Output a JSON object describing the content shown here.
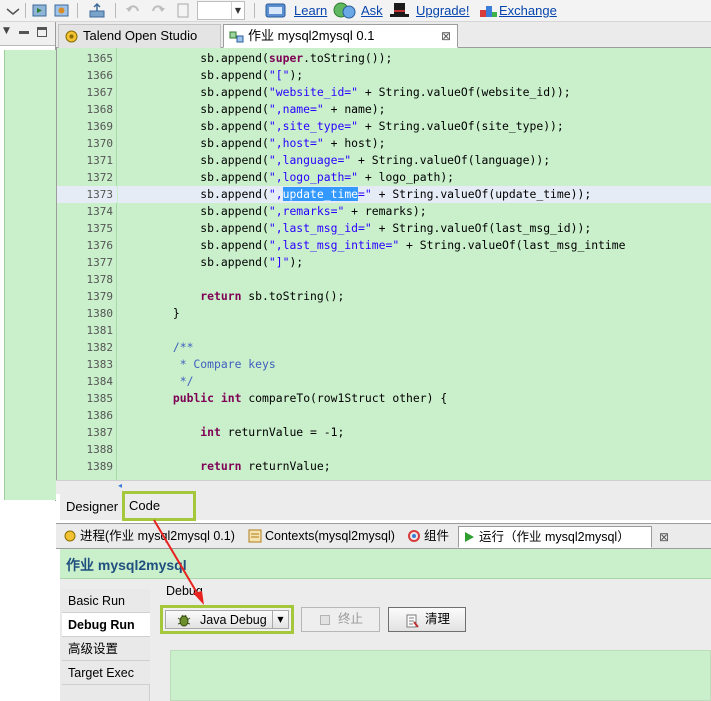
{
  "toolbar": {
    "links": [
      {
        "label": "Learn",
        "icon": "learn-icon"
      },
      {
        "label": "Ask",
        "icon": "ask-icon"
      },
      {
        "label": "Upgrade!",
        "icon": "upgrade-icon"
      },
      {
        "label": "Exchange",
        "icon": "exchange-icon"
      }
    ]
  },
  "editor_tabs": [
    {
      "label": "Talend Open Studio",
      "icon": "talend-icon"
    },
    {
      "label": "作业 mysql2mysql 0.1",
      "icon": "job-icon",
      "close": "⊠"
    }
  ],
  "code": {
    "line_numbers": [
      "1365",
      "1366",
      "1367",
      "1368",
      "1369",
      "1370",
      "1371",
      "1372",
      "1373",
      "1374",
      "1375",
      "1376",
      "1377",
      "1378",
      "1379",
      "1380",
      "1381",
      "1382",
      "1383",
      "1384",
      "1385",
      "1386",
      "1387",
      "1388",
      "1389"
    ],
    "lines": [
      [
        {
          "t": "            sb.append("
        },
        {
          "t": "super",
          "c": "kw"
        },
        {
          "t": ".toString());"
        }
      ],
      [
        {
          "t": "            sb.append("
        },
        {
          "t": "\"[\"",
          "c": "str"
        },
        {
          "t": ");"
        }
      ],
      [
        {
          "t": "            sb.append("
        },
        {
          "t": "\"website_id=\"",
          "c": "str"
        },
        {
          "t": " + String.valueOf(website_id));"
        }
      ],
      [
        {
          "t": "            sb.append("
        },
        {
          "t": "\",name=\"",
          "c": "str"
        },
        {
          "t": " + name);"
        }
      ],
      [
        {
          "t": "            sb.append("
        },
        {
          "t": "\",site_type=\"",
          "c": "str"
        },
        {
          "t": " + String.valueOf(site_type));"
        }
      ],
      [
        {
          "t": "            sb.append("
        },
        {
          "t": "\",host=\"",
          "c": "str"
        },
        {
          "t": " + host);"
        }
      ],
      [
        {
          "t": "            sb.append("
        },
        {
          "t": "\",language=\"",
          "c": "str"
        },
        {
          "t": " + String.valueOf(language));"
        }
      ],
      [
        {
          "t": "            sb.append("
        },
        {
          "t": "\",logo_path=\"",
          "c": "str"
        },
        {
          "t": " + logo_path);"
        }
      ],
      [
        {
          "t": "            sb.append("
        },
        {
          "t": "\",",
          "c": "str"
        },
        {
          "t": "update_time",
          "c": "sel"
        },
        {
          "t": "=\"",
          "c": "str"
        },
        {
          "t": " + String.valueOf(update_time));"
        }
      ],
      [
        {
          "t": "            sb.append("
        },
        {
          "t": "\",remarks=\"",
          "c": "str"
        },
        {
          "t": " + remarks);"
        }
      ],
      [
        {
          "t": "            sb.append("
        },
        {
          "t": "\",last_msg_id=\"",
          "c": "str"
        },
        {
          "t": " + String.valueOf(last_msg_id));"
        }
      ],
      [
        {
          "t": "            sb.append("
        },
        {
          "t": "\",last_msg_intime=\"",
          "c": "str"
        },
        {
          "t": " + String.valueOf(last_msg_intime"
        }
      ],
      [
        {
          "t": "            sb.append("
        },
        {
          "t": "\"]\"",
          "c": "str"
        },
        {
          "t": ");"
        }
      ],
      [
        {
          "t": ""
        }
      ],
      [
        {
          "t": "            "
        },
        {
          "t": "return",
          "c": "kw"
        },
        {
          "t": " sb.toString();"
        }
      ],
      [
        {
          "t": "        }"
        }
      ],
      [
        {
          "t": ""
        }
      ],
      [
        {
          "t": "        "
        },
        {
          "t": "/**",
          "c": "cm"
        }
      ],
      [
        {
          "t": "         * Compare keys",
          "c": "cm"
        }
      ],
      [
        {
          "t": "         */",
          "c": "cm"
        }
      ],
      [
        {
          "t": "        "
        },
        {
          "t": "public",
          "c": "kw"
        },
        {
          "t": " "
        },
        {
          "t": "int",
          "c": "kw"
        },
        {
          "t": " compareTo(row1Struct other) {"
        }
      ],
      [
        {
          "t": ""
        }
      ],
      [
        {
          "t": "            "
        },
        {
          "t": "int",
          "c": "kw"
        },
        {
          "t": " returnValue = -1;"
        }
      ],
      [
        {
          "t": ""
        }
      ],
      [
        {
          "t": "            "
        },
        {
          "t": "return",
          "c": "kw"
        },
        {
          "t": " returnValue;"
        }
      ]
    ],
    "highlighted_line_index": 8
  },
  "designer_tabs": {
    "designer": "Designer",
    "code": "Code"
  },
  "view_tabs": [
    {
      "label": "进程(作业 mysql2mysql 0.1)",
      "icon": "process-icon"
    },
    {
      "label": "Contexts(mysql2mysql)",
      "icon": "contexts-icon"
    },
    {
      "label": "组件",
      "icon": "component-icon"
    },
    {
      "label": "运行（作业 mysql2mysql）",
      "icon": "run-icon",
      "close": "⊠"
    }
  ],
  "run": {
    "title": "作业 mysql2mysql",
    "side_tabs": [
      "Basic Run",
      "Debug Run",
      "高级设置",
      "Target Exec"
    ],
    "active_side_tab": 1,
    "section_label": "Debug",
    "java_debug_label": "Java Debug",
    "stop_label": "终止",
    "clear_label": "清理"
  },
  "colors": {
    "editor_bg": "#c9efcb",
    "annotation": "#a5c73b",
    "arrow": "#e8231f",
    "link": "#0645ad"
  }
}
